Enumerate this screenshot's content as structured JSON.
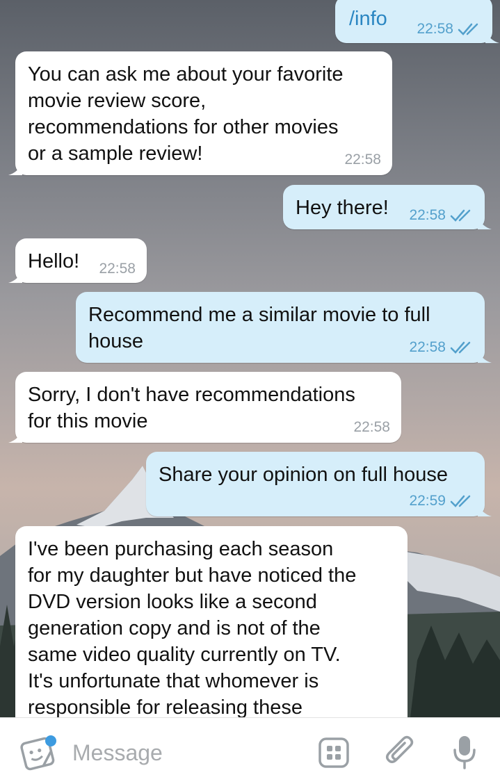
{
  "messages": [
    {
      "id": "m1",
      "direction": "outgoing",
      "text": "/info",
      "time": "22:58",
      "status": "read"
    },
    {
      "id": "m2",
      "direction": "incoming",
      "lines": [
        "You can ask me about your favorite",
        "movie review score,",
        "recommendations for other movies",
        "or a sample review!"
      ],
      "time": "22:58"
    },
    {
      "id": "m3",
      "direction": "outgoing",
      "text": "Hey there!",
      "time": "22:58",
      "status": "read"
    },
    {
      "id": "m4",
      "direction": "incoming",
      "text": "Hello!",
      "time": "22:58"
    },
    {
      "id": "m5",
      "direction": "outgoing",
      "lines": [
        "Recommend me a similar movie to full",
        "house"
      ],
      "time": "22:58",
      "status": "read"
    },
    {
      "id": "m6",
      "direction": "incoming",
      "lines": [
        "Sorry, I don't have recommendations",
        "for this movie"
      ],
      "time": "22:58"
    },
    {
      "id": "m7",
      "direction": "outgoing",
      "text": "Share your opinion on full house",
      "time": "22:59",
      "status": "read"
    },
    {
      "id": "m8",
      "direction": "incoming",
      "lines": [
        "I've been purchasing each season",
        "for my daughter but have noticed the",
        "DVD version looks like a second",
        "generation copy and is not of the",
        "same video quality currently on TV.",
        "It's unfortunate that whomever is",
        "responsible for releasing these"
      ]
    }
  ],
  "composer": {
    "placeholder": "Message",
    "icons": [
      "sticker-icon",
      "bot-keyboard-icon",
      "attach-icon",
      "microphone-icon"
    ]
  },
  "colors": {
    "incoming_bubble": "#ffffff",
    "outgoing_bubble": "#d6eefa",
    "outgoing_meta": "#53a0cc",
    "incoming_meta": "#9aa0a6",
    "accent": "#3d9be0"
  }
}
